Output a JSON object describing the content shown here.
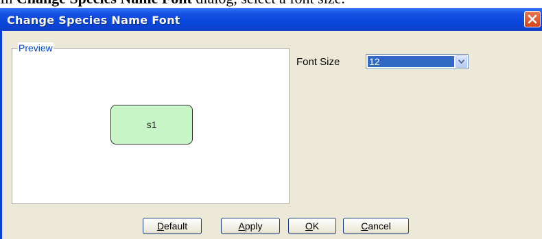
{
  "caption": {
    "prefix": "In ",
    "bold": "Change Species Name Font",
    "suffix": " dialog, select a font size."
  },
  "dialog": {
    "title": "Change Species Name Font",
    "preview": {
      "legend": "Preview",
      "species_label": "s1"
    },
    "font_size": {
      "label": "Font Size",
      "value": "12"
    },
    "buttons": {
      "default": {
        "mnemonic": "D",
        "rest": "efault"
      },
      "apply": {
        "mnemonic": "A",
        "rest": "pply"
      },
      "ok": {
        "mnemonic": "O",
        "rest": "K"
      },
      "cancel": {
        "mnemonic": "C",
        "rest": "ancel"
      }
    }
  },
  "colors": {
    "titlebar": "#0a48dc",
    "client_bg": "#ece9d8",
    "close_button": "#d24318",
    "species_fill": "#c8f5c8",
    "selection": "#316ac5"
  },
  "icons": {
    "close": "close-icon",
    "dropdown": "chevron-down-icon"
  }
}
